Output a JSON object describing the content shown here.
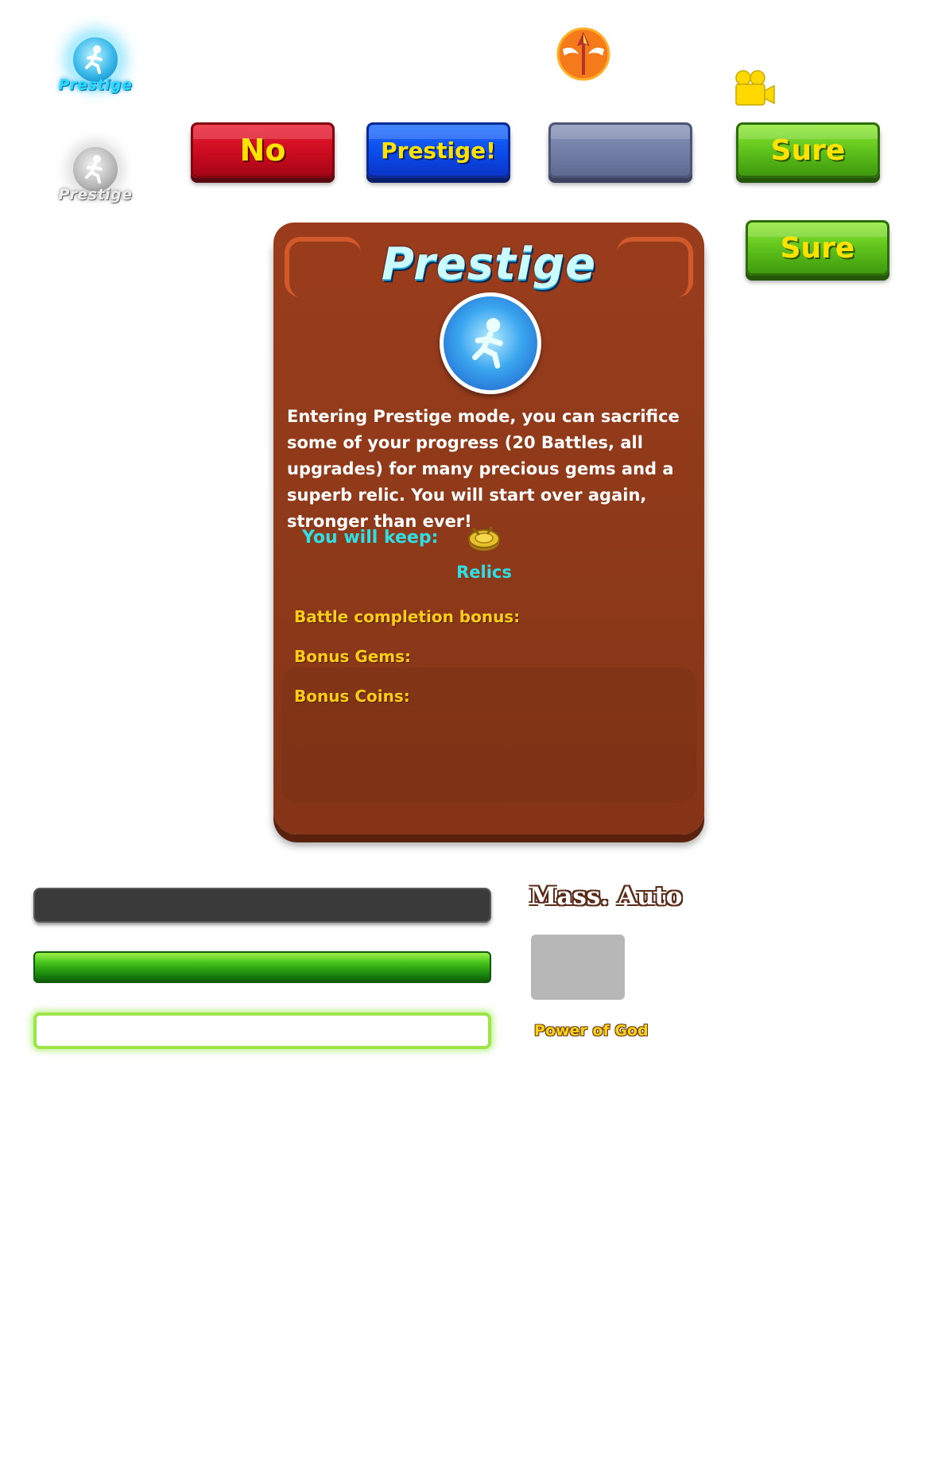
{
  "prestige_icons": {
    "active_label": "Prestige",
    "inactive_label": "Prestige"
  },
  "buttons": {
    "no_label": "No",
    "prestige_label": "Prestige!",
    "grey_label": "",
    "sure_label_1": "Sure",
    "sure_label_2": "Sure"
  },
  "icons": {
    "top_emblem": "winged-spear-icon",
    "video": "video-camera-icon",
    "relic": "relic-coin-icon",
    "prestige": "running-figure-icon"
  },
  "panel": {
    "title": "Prestige",
    "description": "Entering Prestige mode, you can sacrifice some of your progress (20 Battles, all upgrades) for many precious gems and a superb relic. You will start over again, stronger than ever!",
    "keep_label": "You will keep:",
    "relics_label": "Relics",
    "battle_bonus_label": "Battle completion bonus:",
    "bonus_gems_label": "Bonus Gems:",
    "bonus_coins_label": "Bonus Coins:"
  },
  "side": {
    "mass_auto": "Mass. Auto",
    "power_of_god": "Power of God"
  },
  "colors": {
    "panel": "#8e3a1a",
    "accent_cyan": "#2ee0e6",
    "accent_gold": "#ffcc1a",
    "button_red": "#c80a1e",
    "button_blue": "#0a49e8",
    "button_green": "#5bbf1a",
    "button_grey": "#6f7ba3"
  }
}
